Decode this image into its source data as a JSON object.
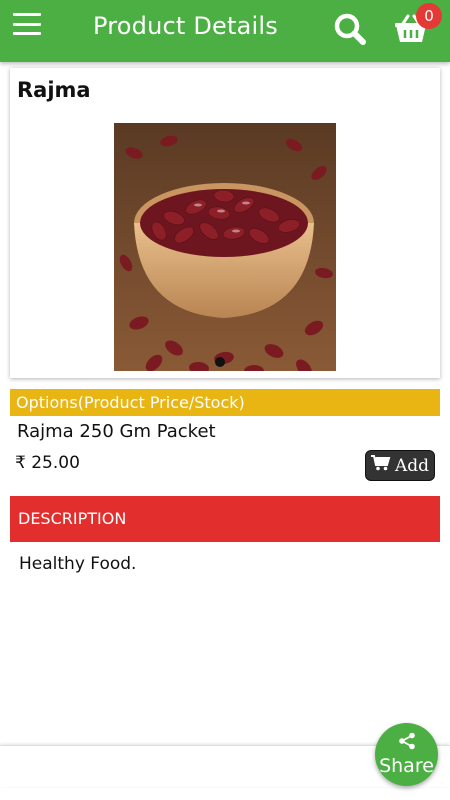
{
  "appbar": {
    "title": "Product Details",
    "cart_count": "0",
    "color": "#4caf43"
  },
  "icons": {
    "menu": "hamburger-menu-icon",
    "search": "search-icon",
    "cart": "shopping-basket-icon",
    "add": "cart-icon",
    "share": "share-icon"
  },
  "product": {
    "name": "Rajma",
    "image_alt": "Bowl of red kidney beans"
  },
  "options": {
    "header": "Options(Product Price/Stock)",
    "color": "#e8b512",
    "variant_name": "Rajma 250 Gm Packet",
    "currency_symbol": "₹",
    "price": "25.00",
    "add_label": "Add"
  },
  "description": {
    "header": "DESCRIPTION",
    "color": "#e32e2e",
    "text": "Healthy Food."
  },
  "share": {
    "label": "Share"
  }
}
